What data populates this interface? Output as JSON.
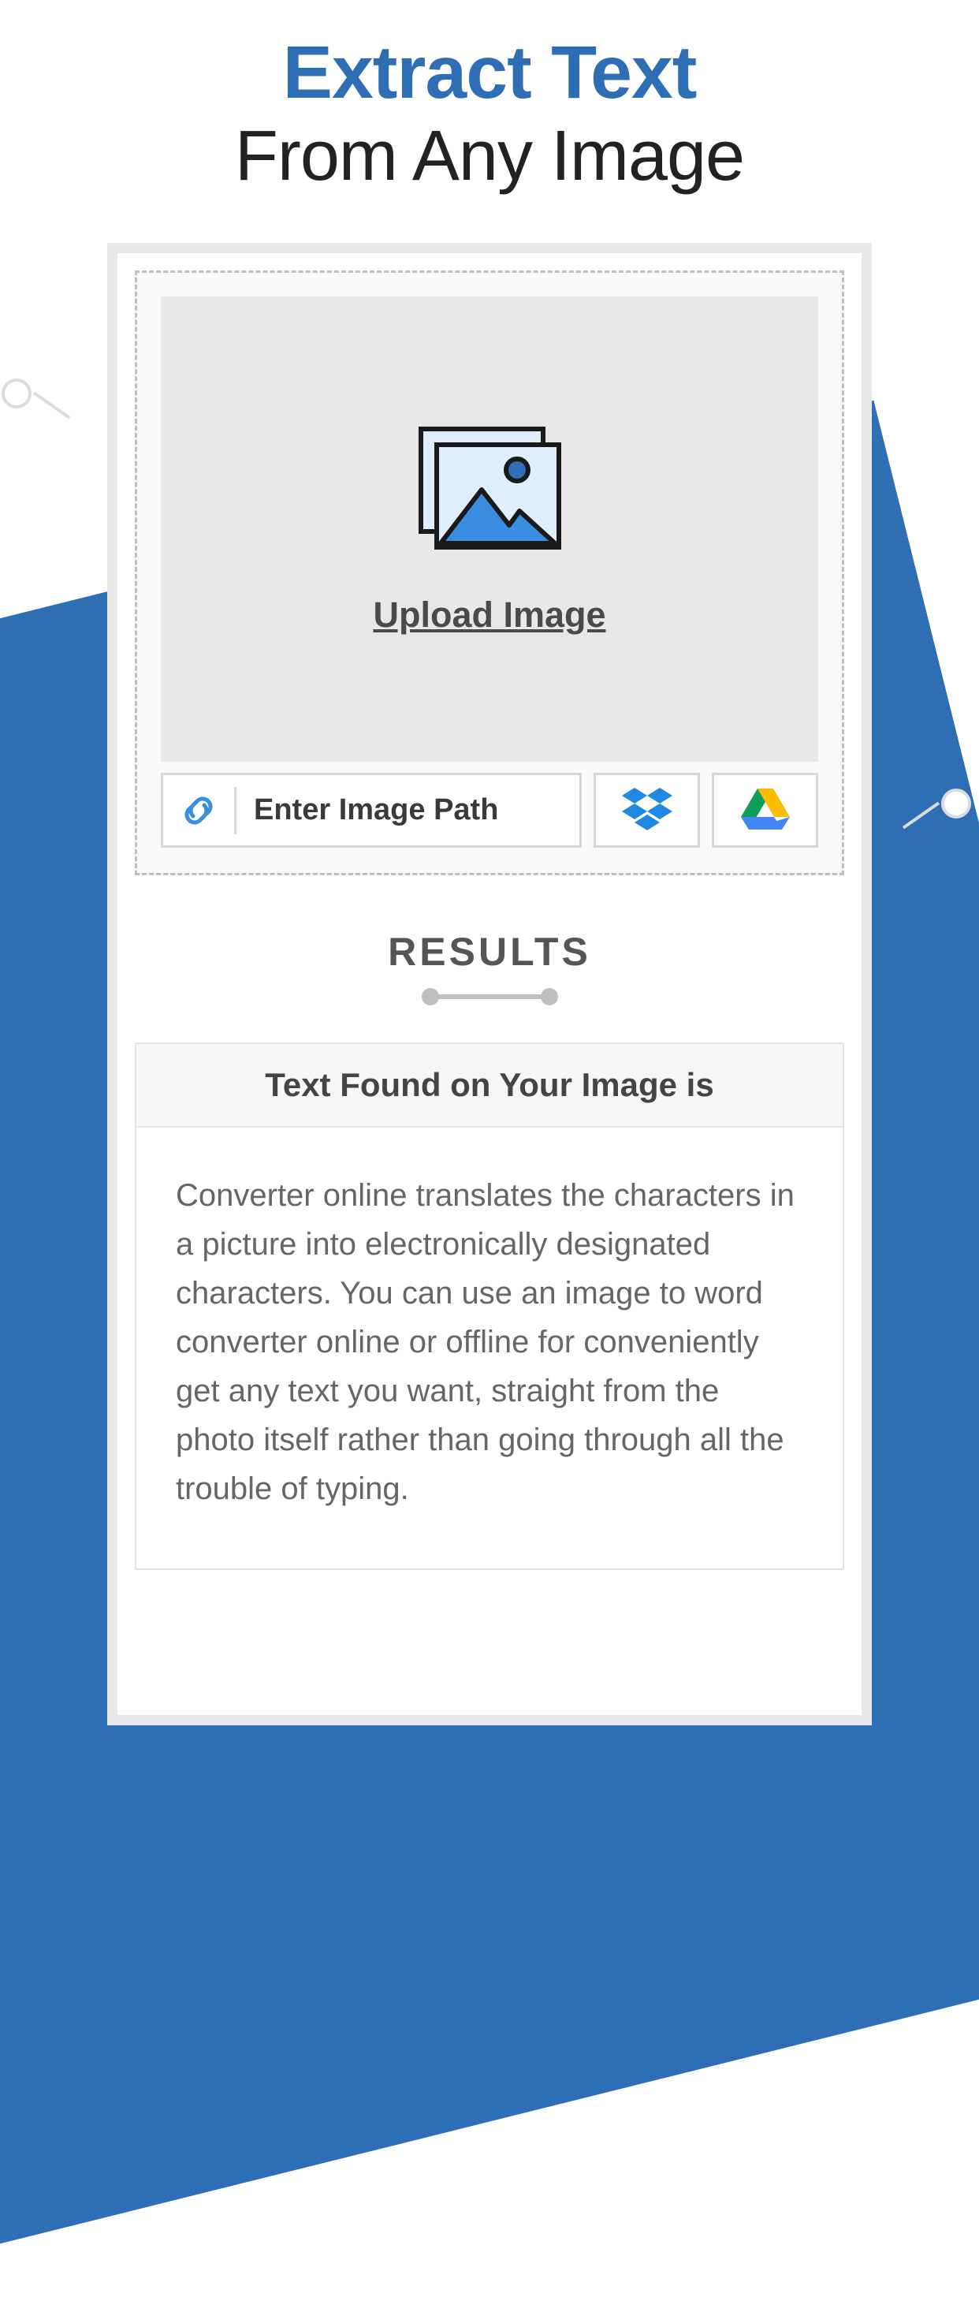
{
  "header": {
    "title_top": "Extract Text",
    "title_bottom": "From Any Image"
  },
  "upload": {
    "drop_label": "Upload Image",
    "path_placeholder": "Enter Image Path"
  },
  "results": {
    "heading": "RESULTS",
    "panel_title": "Text Found on Your Image is",
    "body": "Converter online translates the characters in a picture into electronically designated characters. You can use an image to word converter online or offline for conveniently get any text you want, straight from the photo itself rather than going through all the trouble of typing."
  }
}
